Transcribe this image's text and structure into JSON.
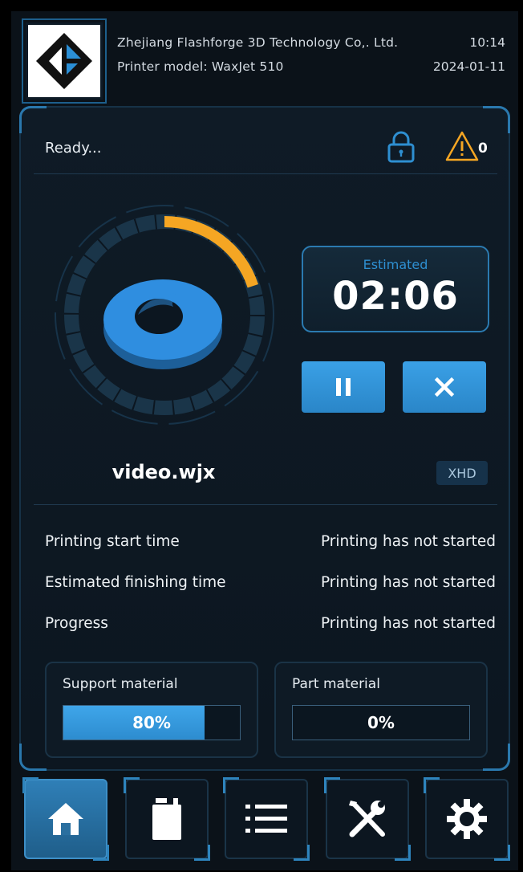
{
  "header": {
    "company": "Zhejiang Flashforge 3D Technology Co,. Ltd.",
    "model_line": "Printer model: WaxJet 510",
    "time": "10:14",
    "date": "2024-01-11"
  },
  "status": {
    "text": "Ready...",
    "warning_count": "0"
  },
  "progress_ring": {
    "progress_fraction": 0.2,
    "accent_color": "#f5a623"
  },
  "estimated": {
    "label": "Estimated",
    "time": "02:06"
  },
  "controls": {
    "pause_icon": "pause-icon",
    "cancel_icon": "close-icon"
  },
  "job": {
    "file_name": "video.wjx",
    "quality": "XHD"
  },
  "info": [
    {
      "label": "Printing start time",
      "value": "Printing has not started"
    },
    {
      "label": "Estimated finishing time",
      "value": "Printing has not started"
    },
    {
      "label": "Progress",
      "value": "Printing has not started"
    }
  ],
  "materials": {
    "support": {
      "label": "Support material",
      "percent_text": "80%",
      "level": 0.8
    },
    "part": {
      "label": "Part material",
      "percent_text": "0%",
      "level": 0.0
    }
  },
  "nav": [
    {
      "name": "home",
      "icon": "home-icon",
      "active": true
    },
    {
      "name": "materials",
      "icon": "cartridge-icon",
      "active": false
    },
    {
      "name": "files",
      "icon": "list-icon",
      "active": false
    },
    {
      "name": "tools",
      "icon": "tools-icon",
      "active": false
    },
    {
      "name": "settings",
      "icon": "gear-icon",
      "active": false
    }
  ],
  "colors": {
    "accent_blue": "#2e8fd1",
    "warning_orange": "#f5a623",
    "background": "#0b1219"
  }
}
